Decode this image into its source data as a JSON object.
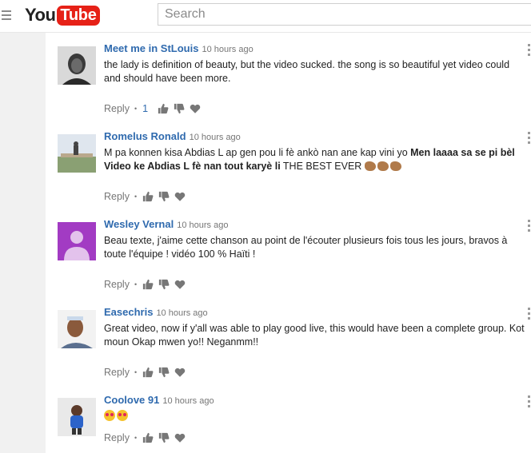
{
  "header": {
    "logo_you": "You",
    "logo_tube": "Tube",
    "search_placeholder": "Search"
  },
  "comments": [
    {
      "author": "Meet me in StLouis",
      "time": "10 hours ago",
      "text": "the lady is definition of beauty, but the video sucked. the song is so beautiful yet video could and should have been more.",
      "reply_label": "Reply",
      "likes": "1"
    },
    {
      "author": "Romelus Ronald",
      "time": "10 hours ago",
      "text_plain": "M pa konnen kisa Abdias L ap gen pou li fè ankò nan ane kap vini yo ",
      "text_bold": "Men laaaa sa se pi bèl Video ke Abdias L fè nan tout karyè li",
      "text_end": "  THE BEST EVER ",
      "reply_label": "Reply"
    },
    {
      "author": "Wesley Vernal",
      "time": "10 hours ago",
      "text": "Beau texte, j'aime cette chanson au point de l'écouter plusieurs fois tous les jours, bravos à toute l'équipe !  vidéo 100 %  Haïti !",
      "reply_label": "Reply"
    },
    {
      "author": "Easechris",
      "time": "10 hours ago",
      "text": "Great video, now if y'all was able to play good live, this would have been a complete group. Kot moun Okap mwen yo!! Neganmm!!",
      "reply_label": "Reply"
    },
    {
      "author": "Coolove 91",
      "time": "10 hours ago",
      "reply_label": "Reply"
    }
  ],
  "colors": {
    "author": "#2f6aae",
    "accent": "#e62117",
    "default_avatar": "#a23bc3"
  },
  "icons": [
    "menu-icon",
    "thumbs-up-icon",
    "thumbs-down-icon",
    "heart-icon",
    "more-vert-icon",
    "clap-emoji",
    "heart-eyes-emoji"
  ]
}
